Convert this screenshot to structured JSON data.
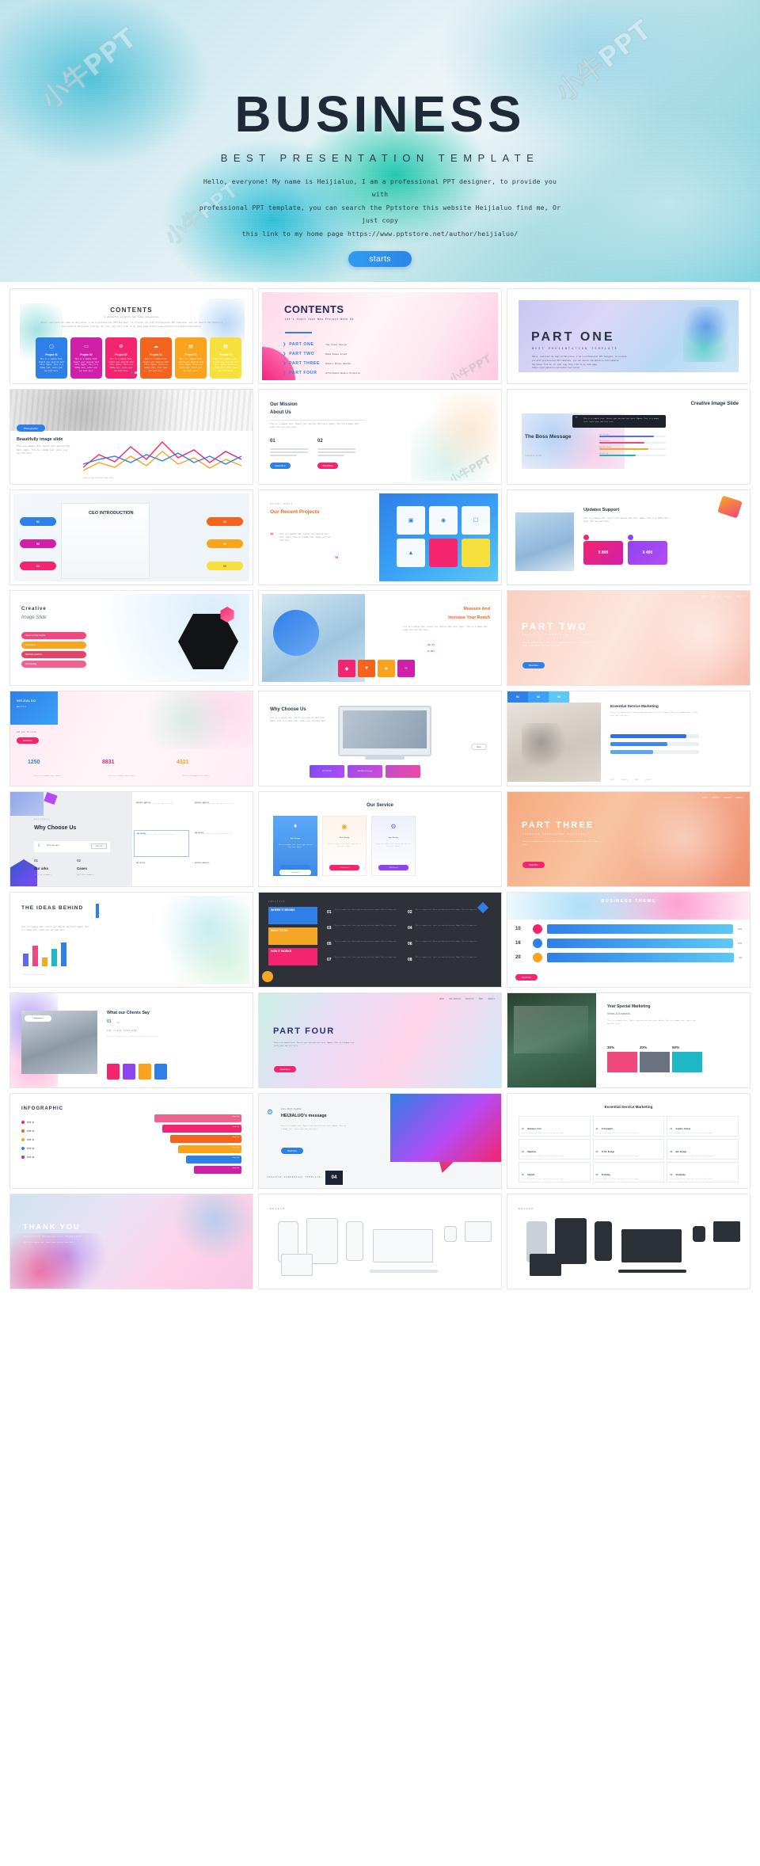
{
  "hero": {
    "title": "BUSINESS",
    "subtitle": "BEST PRESENTATION TEMPLATE",
    "paragraph_line1": "Hello, everyone! My name is Heijialuo, I am a professional PPT designer, to provide you with",
    "paragraph_line2": "professional PPT template, you can search the Pptstore this website Heijialuo find me, Or just copy",
    "paragraph_line3": "this link to my home page https://www.pptstore.net/author/heijialuo/",
    "button_label": "starts",
    "watermark": "小牛PPT",
    "accent_color": "#2f9bf0"
  },
  "slides": [
    {
      "id": "s01",
      "kind": "contents-cards",
      "title": "CONTENTS",
      "subtitle": "A wonderful serenity has taken possession",
      "body": "Hello, everyone! My name is Heijialuo, I am a professional PPT designer, to provide you with professional PPT template, you can search the Pptstore this website Heijialuo find me, Or just copy this link to my home page https://www.pptstore.net/author/heijialuo/",
      "cards": [
        {
          "label": "Project 01",
          "color": "#2f7fe8",
          "icon": "camera-icon"
        },
        {
          "label": "Project 02",
          "color": "#d01fa8",
          "icon": "folder-icon"
        },
        {
          "label": "Project 03",
          "color": "#f5246e",
          "icon": "settings-icon"
        },
        {
          "label": "Project 04",
          "color": "#f4641e",
          "icon": "cloud-icon"
        },
        {
          "label": "Project 05",
          "color": "#f9a41c",
          "icon": "news-icon"
        },
        {
          "label": "Project 06",
          "color": "#f7e03c",
          "icon": "card-icon"
        }
      ],
      "card_text": "This is a sample text. Insert your desired text here. Again, This is a dummy text, enter your own text here.",
      "card_more": "MORE"
    },
    {
      "id": "s02",
      "kind": "contents-list",
      "title": "CONTENTS",
      "subtitle": "Let's Start Your New Project With Us",
      "items": [
        {
          "part": "PART ONE",
          "desc": "Top Class Design"
        },
        {
          "part": "PART TWO",
          "desc": "Make Ideas Great"
        },
        {
          "part": "PART THREE",
          "desc": "Modern Brown Wooden"
        },
        {
          "part": "PART FOUR",
          "desc": "Affordable Modern Products"
        }
      ]
    },
    {
      "id": "s03",
      "kind": "section",
      "title": "PART ONE",
      "subtitle": "BEST PRESENTATION TEMPLATE",
      "body": "Hello, everyone! My name is Heijialuo, I am a professional PPT designer, to provide you with professional PPT template, you can search the Pptstore this website Heijialuo find me, Or just copy this link to my home page https://www.pptstore.net/author/heijialuo/",
      "theme": "g-purple"
    },
    {
      "id": "s04",
      "kind": "photo-chart",
      "title": "Beautifully image slide",
      "badge": "Photographer",
      "body": "This is a sample text. Insert your desired text here. Again, This is a dummy text, enter your own text here.",
      "chart_caption": "Insert your desired text here"
    },
    {
      "id": "s05",
      "kind": "mission",
      "title": "Our Mission",
      "subtitle": "About Us",
      "body": "This is a sample text. Insert your desired text here. Again, This is a dummy text, enter your own text here.",
      "columns": [
        {
          "num": "01",
          "label": "Read More"
        },
        {
          "num": "02",
          "label": "Read More"
        }
      ]
    },
    {
      "id": "s06",
      "kind": "boss-message",
      "title": "Creative Image Slide",
      "quote": "“",
      "heading": "The Boss Message",
      "sub": "Customize slide",
      "bars": [
        {
          "label": "Web Design",
          "value": 82,
          "color": "#5b6af0"
        },
        {
          "label": "Development",
          "value": 68,
          "color": "#f0487c"
        },
        {
          "label": "App Building",
          "value": 74,
          "color": "#f5a623"
        },
        {
          "label": "Marketing",
          "value": 55,
          "color": "#1fb8a6"
        }
      ]
    },
    {
      "id": "s07",
      "kind": "ceo",
      "title": "CEO INTRODUCTION",
      "steps": [
        {
          "num": "01",
          "color": "#2f7fe8"
        },
        {
          "num": "02",
          "color": "#d01fa8"
        },
        {
          "num": "03",
          "color": "#f5246e"
        },
        {
          "num": "04",
          "color": "#f4641e"
        },
        {
          "num": "05",
          "color": "#f9a41c"
        },
        {
          "num": "06",
          "color": "#f7e03c"
        }
      ]
    },
    {
      "id": "s08",
      "kind": "recent-projects",
      "eyebrow": "RECENT WORKS",
      "title": "Our Recent Projects",
      "body": "This is a sample text. Insert your desired text here. Again, This is a dummy text, enter your own text here.",
      "tiles": 6
    },
    {
      "id": "s09",
      "kind": "updates",
      "title": "Updates Support",
      "body": "This is a sample text. Insert your desired text here. Again, This is a dummy text, enter your own text here.",
      "prices": [
        {
          "amount": "¥ 800",
          "color": "#f5246e"
        },
        {
          "amount": "¥ 490",
          "color": "#8e44f0"
        }
      ]
    },
    {
      "id": "s10",
      "kind": "creative-image",
      "title": "Creative",
      "title2": "Image Slide",
      "list": [
        {
          "label": "Donec ac felis fringilla",
          "color": "#f0487c"
        },
        {
          "label": "Start Sport",
          "color": "#f5a623"
        },
        {
          "label": "Business Analysis",
          "color": "#e0466a"
        },
        {
          "label": "Free Setting",
          "color": "#f06292"
        }
      ]
    },
    {
      "id": "s11",
      "kind": "measure",
      "title": "Measure And",
      "title2": "Increase Your Reach",
      "body": "This is a sample text. Insert your desired text here. Again, This is a dummy text, enter your own text here.",
      "stats": [
        {
          "value": "22.5%",
          "label": "Growth"
        },
        {
          "value": "6.65%",
          "label": "Revenue"
        }
      ],
      "icons": [
        "gift-icon",
        "heart-icon",
        "star-icon",
        "bell-icon"
      ]
    },
    {
      "id": "s12",
      "kind": "section",
      "title": "PART TWO",
      "subtitle": "CREATIVE POWERPOINT TEMPLATE",
      "body": "This is a sample text. Insert your desired text here. Again, This is a dummy text, enter your own text here.",
      "theme": "g-peach",
      "button": "Read More"
    },
    {
      "id": "s13",
      "kind": "stats",
      "brand": "HEIJIALUO",
      "brand_sub": "Web Price",
      "button": "Read More",
      "numbers": [
        {
          "value": "1250",
          "caption": "This is a sample text insert"
        },
        {
          "value": "8831",
          "caption": "This is a sample text insert"
        },
        {
          "value": "4321",
          "caption": "This is a sample text insert"
        }
      ],
      "subtitle": "Get your 3D slide"
    },
    {
      "id": "s14",
      "kind": "why-choose",
      "title": "Why Choose Us",
      "body": "This is a sample text. Insert your desired text here. Again, This is a dummy text, enter your own text here.",
      "button": "More",
      "footer": [
        {
          "label": "PPTSTORE"
        },
        {
          "label": "HEIJIALUO Design"
        }
      ]
    },
    {
      "id": "s15",
      "kind": "essential-service",
      "title": "Essential Service Marketing",
      "tabs": [
        "01",
        "02",
        "03"
      ],
      "body": "This is a sample text. Insert your desired text here. Again, This is a dummy text, enter your own text here.",
      "bars": [
        {
          "value": 86,
          "color": "#2f6fe8"
        },
        {
          "value": 64,
          "color": "#2f6fe8"
        },
        {
          "value": 48,
          "color": "#2f6fe8"
        }
      ]
    },
    {
      "id": "s16",
      "kind": "why-choose-2",
      "title": "Why Choose Us",
      "shop": "Shop Designs",
      "explore": "EXPLORE",
      "eyebrow": "BUSINESS",
      "cols": [
        {
          "num": "01",
          "head": "Our arks",
          "sub": "Check our products"
        },
        {
          "num": "02",
          "head": "Cases",
          "sub": "Real life examples"
        }
      ]
    },
    {
      "id": "s17",
      "kind": "our-service",
      "title": "Our Service",
      "cards": [
        {
          "head": "Web Design",
          "button": "Find Projects",
          "icon": "palette-icon"
        },
        {
          "head": "Mock Ready",
          "button": "Find Projects",
          "icon": "rings-icon"
        },
        {
          "head": "App Design",
          "button": "Find Projects",
          "icon": "gear-icon"
        }
      ],
      "card_body": "This is a sample text. Insert your desired text here. Again."
    },
    {
      "id": "s18",
      "kind": "section",
      "title": "PART THREE",
      "subtitle": "CREATIVE POWERPOINT TEMPLATE",
      "body": "This is a sample text. Insert your desired text here. Again, This is a dummy text.",
      "theme": "g-orange",
      "button": "Read More"
    },
    {
      "id": "s19",
      "kind": "ideas-behind",
      "title": "THE IDEAS BEHIND",
      "body": "This is a sample text. Insert your desired text here. Again, This is a dummy text, enter your own text here.",
      "chart_caption": "Insert your desired text"
    },
    {
      "id": "s20",
      "kind": "dark-list",
      "eyebrow": "CREATIVE",
      "blocks": [
        "WHERE IT BEGINS",
        "WHAT TO DO",
        "HOW IT WORKS"
      ],
      "numbers": [
        "01",
        "02",
        "03",
        "04",
        "05",
        "06",
        "07",
        "08"
      ],
      "body": "This is a sample text. Insert your desired text here. Again, This is a dummy text."
    },
    {
      "id": "s21",
      "kind": "pricing-rows",
      "title": "BUSINESS THEME",
      "rows": [
        {
          "num": "10",
          "value": "150",
          "color": "#f5246e"
        },
        {
          "num": "16",
          "value": "178",
          "color": "#2f7fe8"
        },
        {
          "num": "20",
          "value": "99",
          "color": "#f9a41c"
        }
      ],
      "button": "Read More"
    },
    {
      "id": "s22",
      "kind": "clients",
      "title": "What our Clients Say",
      "num": "01",
      "num_sub": "/04",
      "badge": "Photographer",
      "body": "TOP CLASS CREATION",
      "sub": "This is a sample text. Insert your desired text here."
    },
    {
      "id": "s23",
      "kind": "section",
      "title": "PART FOUR",
      "subtitle": "CREATIVE POWERPOINT TEMPLATE",
      "body": "This is a sample text. Insert your desired text here. Again, This is a dummy text, enter your own text here.",
      "theme": "g-multi",
      "button": "Read More",
      "nav": [
        "ABOUT",
        "OUR SERVICE",
        "PROJECTS",
        "TEAM",
        "CONTACT"
      ]
    },
    {
      "id": "s24",
      "kind": "year-marketing",
      "title": "Year Special Marketing",
      "subtitle": "Work & Analysis",
      "body": "This is a sample text. Insert your desired text here. Again, This is a dummy text, enter your own text here.",
      "stats": [
        {
          "value": "30%",
          "color": "#f0487c"
        },
        {
          "value": "20%",
          "color": "#6b7280"
        },
        {
          "value": "50%",
          "color": "#1fb8c6"
        }
      ]
    },
    {
      "id": "s25",
      "kind": "infographic",
      "title": "INFOGRAPHIC",
      "steps": [
        {
          "label": "STEP 01",
          "color": "#f5246e"
        },
        {
          "label": "STEP 02",
          "color": "#f4641e"
        },
        {
          "label": "STEP 03",
          "color": "#f9a41c"
        },
        {
          "label": "STEP 04",
          "color": "#2f7fe8"
        },
        {
          "label": "STEP 05",
          "color": "#d01fa8"
        }
      ],
      "tag": "Step Up"
    },
    {
      "id": "s26",
      "kind": "message",
      "eyebrow": "Let's Start Together",
      "title": "HEIJIALUO's message",
      "body": "This is a sample text. Insert your desired text here. Again, This is a dummy text, enter your own text here.",
      "button": "Read More",
      "footer_label": "CREATIVE POWERPOINT TEMPLATE",
      "page": "04"
    },
    {
      "id": "s27",
      "kind": "essential-grid",
      "title": "Essential Service Marketing",
      "cells": [
        {
          "num": "01",
          "head": "Business Card"
        },
        {
          "num": "02",
          "head": "Infographic"
        },
        {
          "num": "03",
          "head": "Graphic Design"
        },
        {
          "num": "04",
          "head": "Magazine"
        },
        {
          "num": "05",
          "head": "Print Design"
        },
        {
          "num": "06",
          "head": "Web Design"
        },
        {
          "num": "07",
          "head": "Payment"
        },
        {
          "num": "08",
          "head": "Branding"
        },
        {
          "num": "09",
          "head": "Packaging"
        }
      ],
      "cell_body": "This is a sample text. Insert your desired text here. Again."
    },
    {
      "id": "s28",
      "kind": "thank-you",
      "title": "THANK YOU",
      "subtitle": "Creative Powerpoint Template",
      "body": "This is a sample text. Insert your desired text here."
    },
    {
      "id": "s29",
      "kind": "device-light",
      "title": "DEVICE",
      "devices": [
        "phone",
        "tablet",
        "phone-2",
        "laptop",
        "watch",
        "monitor"
      ]
    },
    {
      "id": "s30",
      "kind": "device-dark",
      "title": "DEVICE",
      "devices": [
        "phone",
        "tablet",
        "phone-2",
        "laptop",
        "watch",
        "monitor"
      ]
    }
  ]
}
